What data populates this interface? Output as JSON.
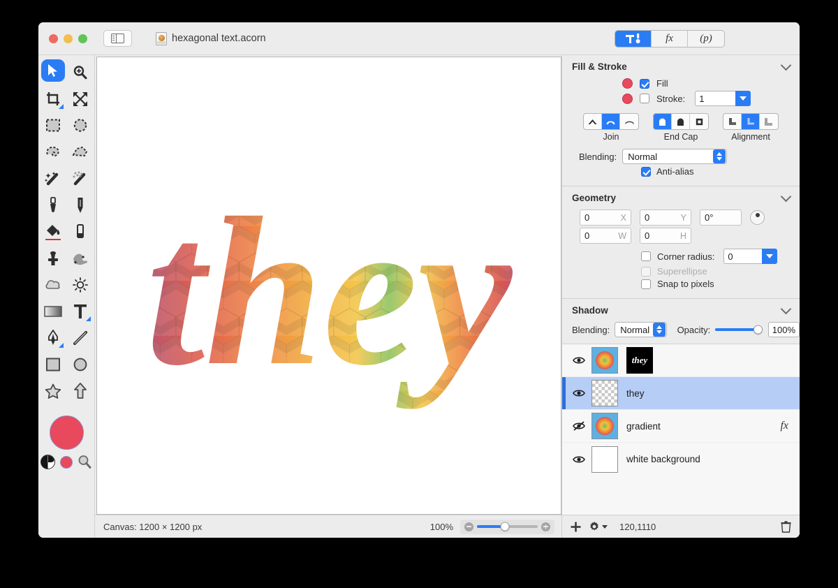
{
  "window": {
    "traffic_lights": [
      "close",
      "minimize",
      "zoom"
    ],
    "sidebar_toggle": "sidebar-toggle",
    "document_title": "hexagonal text.acorn",
    "mode_tabs": [
      {
        "id": "tools",
        "label": "⚒",
        "active": true
      },
      {
        "id": "filters",
        "label": "fx",
        "active": false
      },
      {
        "id": "presets",
        "label": "(p)",
        "active": false
      }
    ]
  },
  "tools": {
    "rows": [
      [
        {
          "name": "move-selection-tool",
          "selected": true
        },
        {
          "name": "zoom-tool",
          "selected": false
        }
      ],
      [
        {
          "name": "crop-tool",
          "selected": false
        },
        {
          "name": "transform-tool",
          "selected": false
        }
      ],
      [
        {
          "name": "rectangular-marquee-tool",
          "selected": false
        },
        {
          "name": "elliptical-marquee-tool",
          "selected": false
        }
      ],
      [
        {
          "name": "lasso-tool",
          "selected": false
        },
        {
          "name": "polygon-lasso-tool",
          "selected": false
        }
      ],
      [
        {
          "name": "magic-wand-tool",
          "selected": false
        },
        {
          "name": "instant-alpha-tool",
          "selected": false
        }
      ],
      [
        {
          "name": "brush-tool",
          "selected": false
        },
        {
          "name": "pencil-tool",
          "selected": false
        }
      ],
      [
        {
          "name": "paint-bucket-tool",
          "selected": false
        },
        {
          "name": "eraser-tool",
          "selected": false
        }
      ],
      [
        {
          "name": "clone-stamp-tool",
          "selected": false
        },
        {
          "name": "smudge-tool",
          "selected": false
        }
      ],
      [
        {
          "name": "blur-tool",
          "selected": false
        },
        {
          "name": "dodge-burn-tool",
          "selected": false
        }
      ],
      [
        {
          "name": "gradient-tool",
          "selected": false
        },
        {
          "name": "text-tool",
          "selected": false
        }
      ],
      [
        {
          "name": "bezier-pen-tool",
          "selected": false
        },
        {
          "name": "line-tool",
          "selected": false
        }
      ],
      [
        {
          "name": "rectangle-shape-tool",
          "selected": false
        },
        {
          "name": "ellipse-shape-tool",
          "selected": false
        }
      ],
      [
        {
          "name": "star-shape-tool",
          "selected": false
        },
        {
          "name": "arrow-shape-tool",
          "selected": false
        }
      ]
    ],
    "swatches": {
      "foreground_color": "#e8495c",
      "secondary_color": "#e8495c",
      "bw_reset": "black-white-swatch",
      "color_picker": "magnifier-picker"
    }
  },
  "canvas": {
    "artwork_text": "they",
    "size_label": "Canvas: 1200 × 1200 px",
    "zoom_label": "100%",
    "zoom_value": 46,
    "pattern": "hexagonal",
    "gradient_colors": [
      "#8e5a9e",
      "#b8556f",
      "#e06050",
      "#ef8445",
      "#f2a93e",
      "#f5c84a",
      "#8fc060",
      "#f5c84a",
      "#ef8445",
      "#d8574f",
      "#a4518f",
      "#7b5aa8"
    ]
  },
  "inspector": {
    "fill_stroke": {
      "title": "Fill & Stroke",
      "fill_label": "Fill",
      "fill_checked": true,
      "fill_color": "#e8495c",
      "stroke_label": "Stroke:",
      "stroke_checked": false,
      "stroke_color": "#e8495c",
      "stroke_width": "1",
      "join_label": "Join",
      "join_options": [
        "miter-join",
        "round-join",
        "bevel-join"
      ],
      "join_selected": 1,
      "endcap_label": "End Cap",
      "endcap_options": [
        "butt-cap",
        "round-cap",
        "square-cap"
      ],
      "endcap_selected": 0,
      "alignment_label": "Alignment",
      "alignment_options": [
        "align-inside",
        "align-center",
        "align-outside"
      ],
      "alignment_selected": 1,
      "blending_label": "Blending:",
      "blending_value": "Normal",
      "antialias_label": "Anti-alias",
      "antialias_checked": true
    },
    "geometry": {
      "title": "Geometry",
      "x_value": "0",
      "x_unit": "X",
      "y_value": "0",
      "y_unit": "Y",
      "angle_value": "0°",
      "w_value": "0",
      "w_unit": "W",
      "h_value": "0",
      "h_unit": "H",
      "corner_radius_label": "Corner radius:",
      "corner_radius_checked": false,
      "corner_radius_value": "0",
      "superellipse_label": "Superellipse",
      "superellipse_checked": false,
      "superellipse_disabled": true,
      "snap_label": "Snap to pixels",
      "snap_checked": false
    },
    "shadow": {
      "title": "Shadow",
      "blending_label": "Blending:",
      "blending_value": "Normal",
      "opacity_label": "Opacity:",
      "opacity_value": "100%",
      "opacity_percent": 100
    }
  },
  "layers": {
    "items": [
      {
        "name": "",
        "visible": true,
        "selected": false,
        "thumb": "gradient-radial",
        "mask_thumb": "they",
        "has_fx": false
      },
      {
        "name": "they",
        "visible": true,
        "selected": true,
        "thumb": "transparent",
        "has_fx": false
      },
      {
        "name": "gradient",
        "visible": false,
        "selected": false,
        "thumb": "gradient-radial",
        "has_fx": true,
        "fx_label": "fx"
      },
      {
        "name": "white background",
        "visible": true,
        "selected": false,
        "thumb": "white",
        "has_fx": false
      }
    ],
    "toolbar": {
      "add_label": "+",
      "settings_label": "gear",
      "coordinates": "120,1110",
      "delete_label": "trash"
    }
  }
}
